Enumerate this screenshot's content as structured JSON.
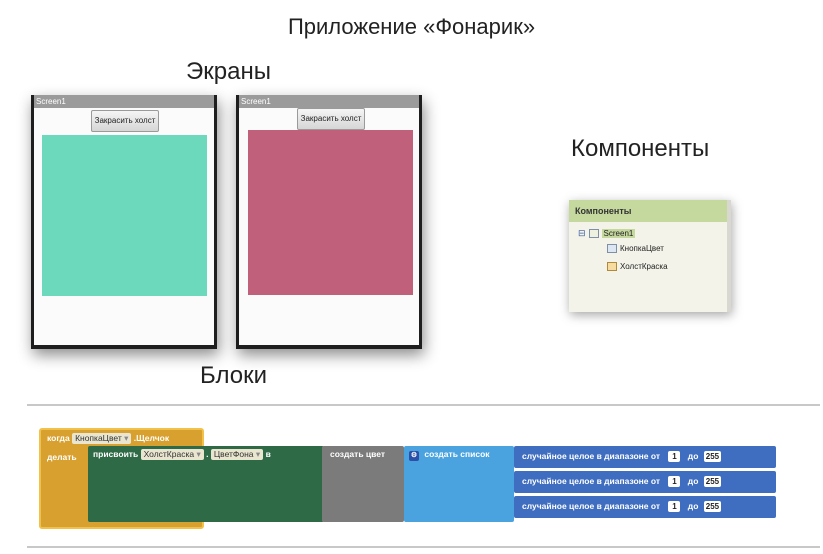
{
  "titles": {
    "app": "Приложение «Фонарик»",
    "screens": "Экраны",
    "components": "Компоненты",
    "blocks": "Блоки"
  },
  "phones": [
    {
      "title": "Screen1",
      "button": "Закрасить холст",
      "canvas_color": "#6cd9bd"
    },
    {
      "title": "Screen1",
      "button": "Закрасить холст",
      "canvas_color": "#c1607b"
    }
  ],
  "components_panel": {
    "header": "Компоненты",
    "collapse_symbol": "⊟",
    "root": "Screen1",
    "children": [
      "КнопкаЦвет",
      "ХолстКраска"
    ]
  },
  "blocks": {
    "when_label": "когда",
    "button_component": "КнопкаЦвет",
    "event": ".Щелчок",
    "do_label": "делать",
    "set_label": "присвоить",
    "canvas_component": "ХолстКраска",
    "property": "ЦветФона",
    "to_label": "в",
    "make_color": "создать цвет",
    "make_list": "создать список",
    "random_rows": [
      {
        "label": "случайное целое в диапазоне от",
        "from": "1",
        "to_label": "до",
        "to": "255"
      },
      {
        "label": "случайное целое в диапазоне от",
        "from": "1",
        "to_label": "до",
        "to": "255"
      },
      {
        "label": "случайное целое в диапазоне от",
        "from": "1",
        "to_label": "до",
        "to": "255"
      }
    ],
    "colors": {
      "event": "#d8a02e",
      "set": "#2e6a45",
      "make_color": "#7b7b7b",
      "make_list": "#4aa3df",
      "random": "#3f6dc0"
    }
  }
}
